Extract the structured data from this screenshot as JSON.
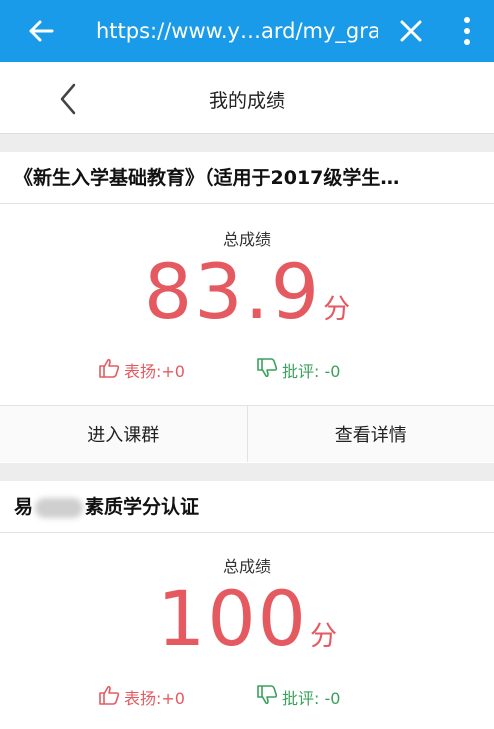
{
  "browser": {
    "url": "https://www.y…ard/my_grade"
  },
  "header": {
    "title": "我的成绩"
  },
  "courses": [
    {
      "name": "《新生入学基础教育》（适用于2017级学生…",
      "score_label": "总成绩",
      "score": "83.9",
      "unit": "分",
      "praise": "表扬:+0",
      "critique": "批评: -0",
      "enter_label": "进入课群",
      "detail_label": "查看详情"
    },
    {
      "name_prefix": "易",
      "name_suffix": "素质学分认证",
      "score_label": "总成绩",
      "score": "100",
      "unit": "分",
      "praise": "表扬:+0",
      "critique": "批评: -0"
    }
  ],
  "icons": {
    "back": "arrow-left-icon",
    "close": "close-icon",
    "more": "more-vertical-icon",
    "nav_back": "chevron-left-icon",
    "praise": "thumbs-up-icon",
    "critique": "thumbs-down-icon"
  },
  "colors": {
    "topbar": "#1a9bea",
    "score": "#e55a60",
    "praise": "#e55a60",
    "critique": "#3aa15b"
  }
}
